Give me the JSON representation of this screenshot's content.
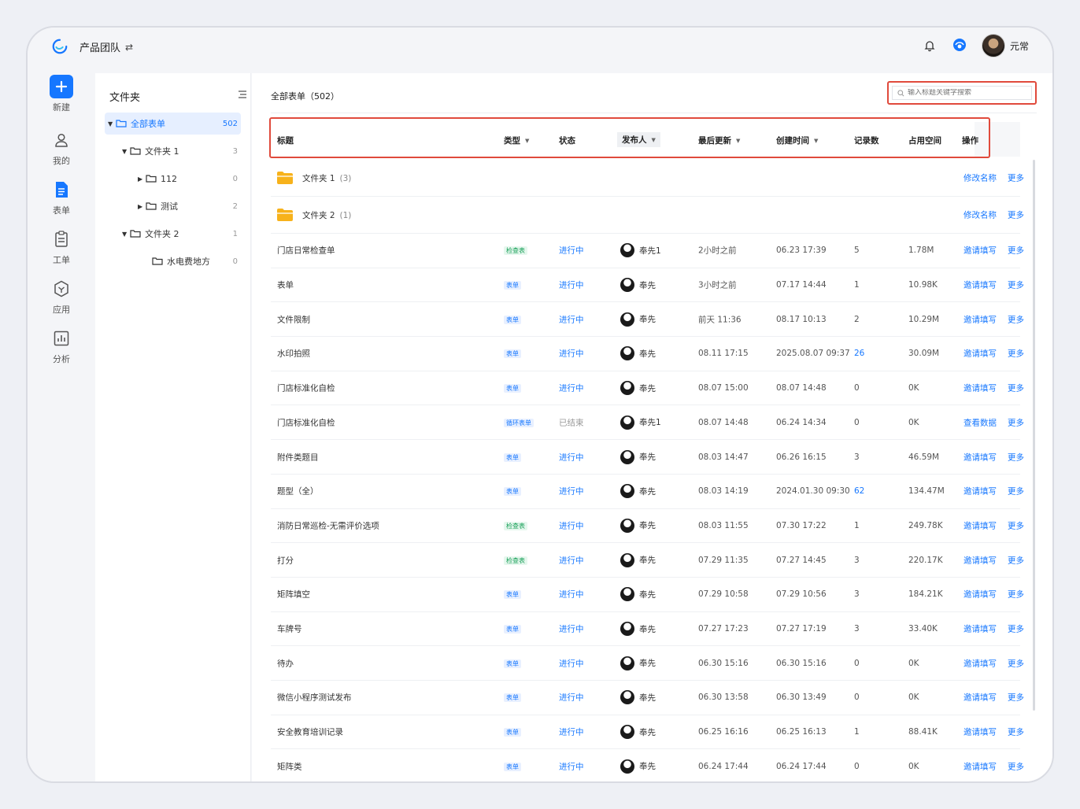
{
  "topbar": {
    "team_name": "产品团队",
    "swap_icon": "⇄",
    "user_name": "元常"
  },
  "nav": [
    {
      "label": "新建",
      "icon": "plus-icon"
    },
    {
      "label": "我的",
      "icon": "user-icon"
    },
    {
      "label": "表单",
      "icon": "form-icon"
    },
    {
      "label": "工单",
      "icon": "clipboard-icon"
    },
    {
      "label": "应用",
      "icon": "app-icon"
    },
    {
      "label": "分析",
      "icon": "chart-icon"
    }
  ],
  "folders": {
    "title": "文件夹",
    "items": [
      {
        "label": "全部表单",
        "count": "502"
      },
      {
        "label": "文件夹 1",
        "count": "3"
      },
      {
        "label": "112",
        "count": "0"
      },
      {
        "label": "测试",
        "count": "2"
      },
      {
        "label": "文件夹 2",
        "count": "1"
      },
      {
        "label": "水电费地方",
        "count": "0"
      }
    ]
  },
  "main": {
    "title": "全部表单（502）",
    "search_placeholder": "输入标题关键字搜索",
    "columns": [
      "标题",
      "类型",
      "状态",
      "发布人",
      "最后更新",
      "创建时间",
      "记录数",
      "占用空间",
      "操作"
    ],
    "folder_rows": [
      {
        "name": "文件夹 1",
        "count": "(3)",
        "op1": "修改名称",
        "op2": "更多"
      },
      {
        "name": "文件夹 2",
        "count": "(1)",
        "op1": "修改名称",
        "op2": "更多"
      }
    ],
    "rows": [
      {
        "title": "门店日常检查单",
        "type": "检查表",
        "status": "进行中",
        "publisher": "奉先1",
        "updated": "2小时之前",
        "created": "06.23 17:39",
        "records": "5",
        "space": "1.78M",
        "op1": "邀请填写",
        "op2": "更多"
      },
      {
        "title": "表单",
        "type": "表单",
        "status": "进行中",
        "publisher": "奉先",
        "updated": "3小时之前",
        "created": "07.17 14:44",
        "records": "1",
        "space": "10.98K",
        "op1": "邀请填写",
        "op2": "更多"
      },
      {
        "title": "文件限制",
        "type": "表单",
        "status": "进行中",
        "publisher": "奉先",
        "updated": "前天 11:36",
        "created": "08.17 10:13",
        "records": "2",
        "space": "10.29M",
        "op1": "邀请填写",
        "op2": "更多"
      },
      {
        "title": "水印拍照",
        "type": "表单",
        "status": "进行中",
        "publisher": "奉先",
        "updated": "08.11 17:15",
        "created": "2025.08.07 09:37",
        "records": "26",
        "space": "30.09M",
        "op1": "邀请填写",
        "op2": "更多"
      },
      {
        "title": "门店标准化自检",
        "type": "表单",
        "status": "进行中",
        "publisher": "奉先",
        "updated": "08.07 15:00",
        "created": "08.07 14:48",
        "records": "0",
        "space": "0K",
        "op1": "邀请填写",
        "op2": "更多"
      },
      {
        "title": "门店标准化自检",
        "type": "循环表单",
        "status": "已结束",
        "publisher": "奉先1",
        "updated": "08.07 14:48",
        "created": "06.24 14:34",
        "records": "0",
        "space": "0K",
        "op1": "查看数据",
        "op2": "更多"
      },
      {
        "title": "附件类题目",
        "type": "表单",
        "status": "进行中",
        "publisher": "奉先",
        "updated": "08.03 14:47",
        "created": "06.26 16:15",
        "records": "3",
        "space": "46.59M",
        "op1": "邀请填写",
        "op2": "更多"
      },
      {
        "title": "题型（全）",
        "type": "表单",
        "status": "进行中",
        "publisher": "奉先",
        "updated": "08.03 14:19",
        "created": "2024.01.30 09:30",
        "records": "62",
        "space": "134.47M",
        "op1": "邀请填写",
        "op2": "更多"
      },
      {
        "title": "消防日常巡检-无需评价选项",
        "type": "检查表",
        "status": "进行中",
        "publisher": "奉先",
        "updated": "08.03 11:55",
        "created": "07.30 17:22",
        "records": "1",
        "space": "249.78K",
        "op1": "邀请填写",
        "op2": "更多"
      },
      {
        "title": "打分",
        "type": "检查表",
        "status": "进行中",
        "publisher": "奉先",
        "updated": "07.29 11:35",
        "created": "07.27 14:45",
        "records": "3",
        "space": "220.17K",
        "op1": "邀请填写",
        "op2": "更多"
      },
      {
        "title": "矩阵填空",
        "type": "表单",
        "status": "进行中",
        "publisher": "奉先",
        "updated": "07.29 10:58",
        "created": "07.29 10:56",
        "records": "3",
        "space": "184.21K",
        "op1": "邀请填写",
        "op2": "更多"
      },
      {
        "title": "车牌号",
        "type": "表单",
        "status": "进行中",
        "publisher": "奉先",
        "updated": "07.27 17:23",
        "created": "07.27 17:19",
        "records": "3",
        "space": "33.40K",
        "op1": "邀请填写",
        "op2": "更多"
      },
      {
        "title": "待办",
        "type": "表单",
        "status": "进行中",
        "publisher": "奉先",
        "updated": "06.30 15:16",
        "created": "06.30 15:16",
        "records": "0",
        "space": "0K",
        "op1": "邀请填写",
        "op2": "更多"
      },
      {
        "title": "微信小程序测试发布",
        "type": "表单",
        "status": "进行中",
        "publisher": "奉先",
        "updated": "06.30 13:58",
        "created": "06.30 13:49",
        "records": "0",
        "space": "0K",
        "op1": "邀请填写",
        "op2": "更多"
      },
      {
        "title": "安全教育培训记录",
        "type": "表单",
        "status": "进行中",
        "publisher": "奉先",
        "updated": "06.25 16:16",
        "created": "06.25 16:13",
        "records": "1",
        "space": "88.41K",
        "op1": "邀请填写",
        "op2": "更多"
      },
      {
        "title": "矩阵类",
        "type": "表单",
        "status": "进行中",
        "publisher": "奉先",
        "updated": "06.24 17:44",
        "created": "06.24 17:44",
        "records": "0",
        "space": "0K",
        "op1": "邀请填写",
        "op2": "更多"
      }
    ]
  },
  "colors": {
    "accent": "#1677ff",
    "highlight": "#e04a3c",
    "folder": "#f7b21b",
    "check_tag": "#18a058"
  }
}
